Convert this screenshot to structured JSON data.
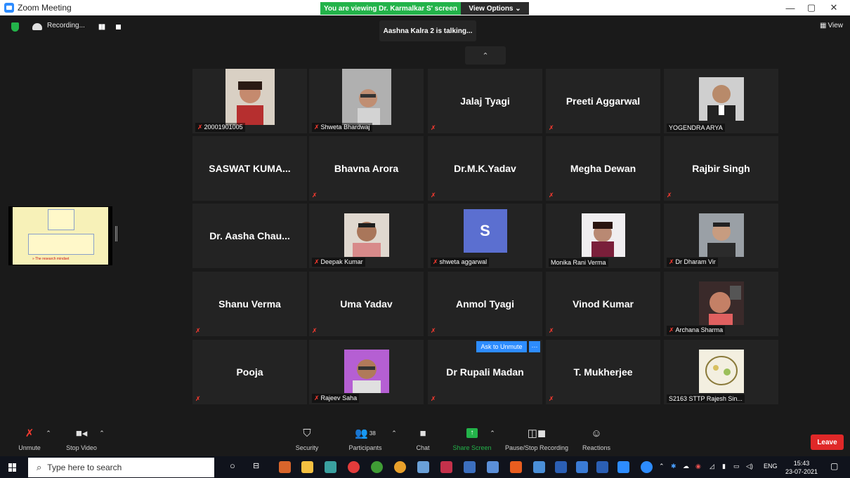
{
  "window": {
    "title": "Zoom Meeting",
    "min": "—",
    "max": "▢",
    "close": "✕"
  },
  "banner": {
    "viewing": "You are viewing Dr. Karmalkar S' screen",
    "view_options": "View Options ⌄"
  },
  "topbar": {
    "recording": "Recording...",
    "talking": "Aashna Kalra 2 is talking...",
    "view": "View",
    "collapse": "⌃"
  },
  "tiles": [
    {
      "label": "20001901005",
      "kind": "photo"
    },
    {
      "label": "Shweta Bhardwaj",
      "kind": "photo"
    },
    {
      "label": "Jalaj Tyagi",
      "kind": "name"
    },
    {
      "label": "Preeti Aggarwal",
      "kind": "name"
    },
    {
      "label": "YOGENDRA ARYA",
      "kind": "photo"
    },
    {
      "label": "SASWAT  KUMA...",
      "kind": "name"
    },
    {
      "label": "Bhavna Arora",
      "kind": "name"
    },
    {
      "label": "Dr.M.K.Yadav",
      "kind": "name"
    },
    {
      "label": "Megha Dewan",
      "kind": "name"
    },
    {
      "label": "Rajbir Singh",
      "kind": "name"
    },
    {
      "label": "Dr. Aasha Chau...",
      "kind": "name"
    },
    {
      "label": "Deepak Kumar",
      "kind": "photo"
    },
    {
      "label": "shweta aggarwal",
      "kind": "avatar",
      "avatar": "S"
    },
    {
      "label": "Monika Rani Verma",
      "kind": "photo"
    },
    {
      "label": "Dr Dharam Vir",
      "kind": "photo"
    },
    {
      "label": "Shanu Verma",
      "kind": "name"
    },
    {
      "label": "Uma Yadav",
      "kind": "name"
    },
    {
      "label": "Anmol Tyagi",
      "kind": "name"
    },
    {
      "label": "Vinod Kumar",
      "kind": "name"
    },
    {
      "label": "Archana Sharma",
      "kind": "photo"
    },
    {
      "label": "Pooja",
      "kind": "name"
    },
    {
      "label": "Rajeev Saha",
      "kind": "photo"
    },
    {
      "label": "Dr Rupali Madan",
      "kind": "name"
    },
    {
      "label": "T. Mukherjee",
      "kind": "name"
    },
    {
      "label": "S2163 STTP Rajesh Sin...",
      "kind": "photo"
    }
  ],
  "ask_unmute": {
    "label": "Ask to Unmute",
    "more": "···"
  },
  "share_thumb": {
    "caption": "» The research mindset"
  },
  "toolbar": {
    "unmute": "Unmute",
    "stop_video": "Stop Video",
    "security": "Security",
    "participants": "Participants",
    "participants_count": "38",
    "chat": "Chat",
    "share_screen": "Share Screen",
    "pause_recording": "Pause/Stop Recording",
    "reactions": "Reactions",
    "leave": "Leave"
  },
  "taskbar": {
    "search_placeholder": "Type here to search",
    "lang": "ENG",
    "time": "15:43",
    "date": "23-07-2021"
  },
  "colors": {
    "green": "#23b34a",
    "blue": "#2d8cff",
    "red": "#e02828",
    "tile": "#232323"
  }
}
